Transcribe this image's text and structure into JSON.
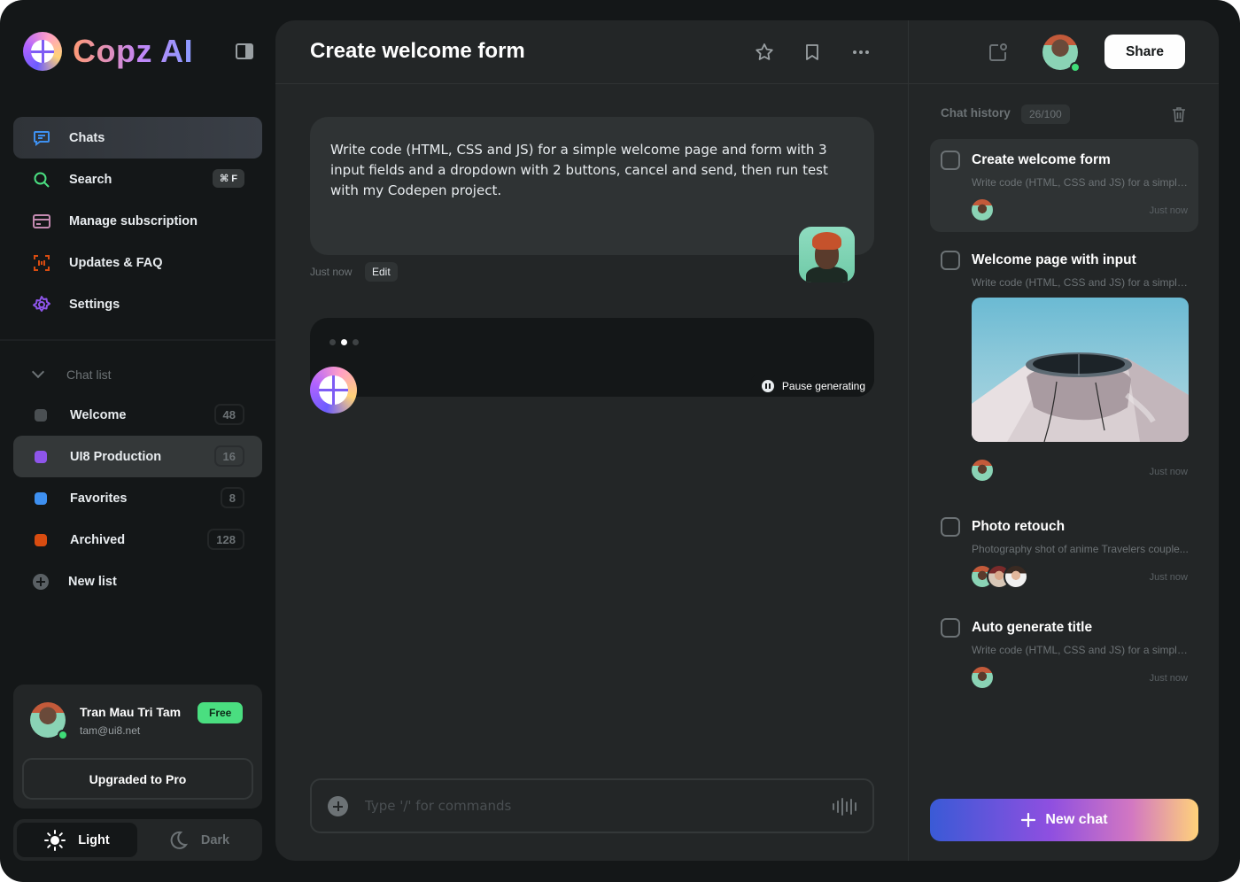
{
  "brand": {
    "name": "Copz AI"
  },
  "nav": [
    {
      "label": "Chats",
      "icon": "chat-icon",
      "active": true
    },
    {
      "label": "Search",
      "icon": "search-icon",
      "shortcut": "⌘ F"
    },
    {
      "label": "Manage subscription",
      "icon": "card-icon"
    },
    {
      "label": "Updates & FAQ",
      "icon": "scan-icon"
    },
    {
      "label": "Settings",
      "icon": "gear-icon"
    }
  ],
  "chat_list": {
    "header": "Chat list",
    "items": [
      {
        "label": "Welcome",
        "count": "48",
        "color": "#4a4f52"
      },
      {
        "label": "UI8 Production",
        "count": "16",
        "color": "#8e55ea",
        "active": true
      },
      {
        "label": "Favorites",
        "count": "8",
        "color": "#3e90f0"
      },
      {
        "label": "Archived",
        "count": "128",
        "color": "#d84c10"
      }
    ],
    "new_list": "New list"
  },
  "user": {
    "name": "Tran Mau Tri Tam",
    "email": "tam@ui8.net",
    "plan": "Free",
    "upgrade": "Upgraded to Pro"
  },
  "theme": {
    "light": "Light",
    "dark": "Dark",
    "selected": "Light"
  },
  "main": {
    "title": "Create welcome form",
    "user_message": "Write code (HTML, CSS and JS) for a simple welcome page and form with 3 input fields and a dropdown with 2 buttons, cancel and send, then run test with my Codepen project.",
    "message_time": "Just now",
    "edit": "Edit",
    "pause": "Pause generating",
    "composer_placeholder": "Type '/' for commands"
  },
  "right": {
    "share": "Share",
    "history_label": "Chat history",
    "history_count": "26/100",
    "items": [
      {
        "title": "Create welcome form",
        "subtitle": "Write code (HTML, CSS and JS) for a simple...",
        "time": "Just now"
      },
      {
        "title": "Welcome page with input",
        "subtitle": "Write code (HTML, CSS and JS) for a simple...",
        "time": "Just now"
      },
      {
        "title": "Photo retouch",
        "subtitle": "Photography shot of anime Travelers couple...",
        "time": "Just now"
      },
      {
        "title": "Auto generate title",
        "subtitle": "Write code (HTML, CSS and JS) for a simple...",
        "time": "Just now"
      }
    ],
    "new_chat": "New chat"
  },
  "colors": {
    "background": "#141718",
    "panel": "#232627",
    "accent_purple": "#8e55ea",
    "online": "#3fdd78",
    "free_badge": "#4ade80"
  }
}
